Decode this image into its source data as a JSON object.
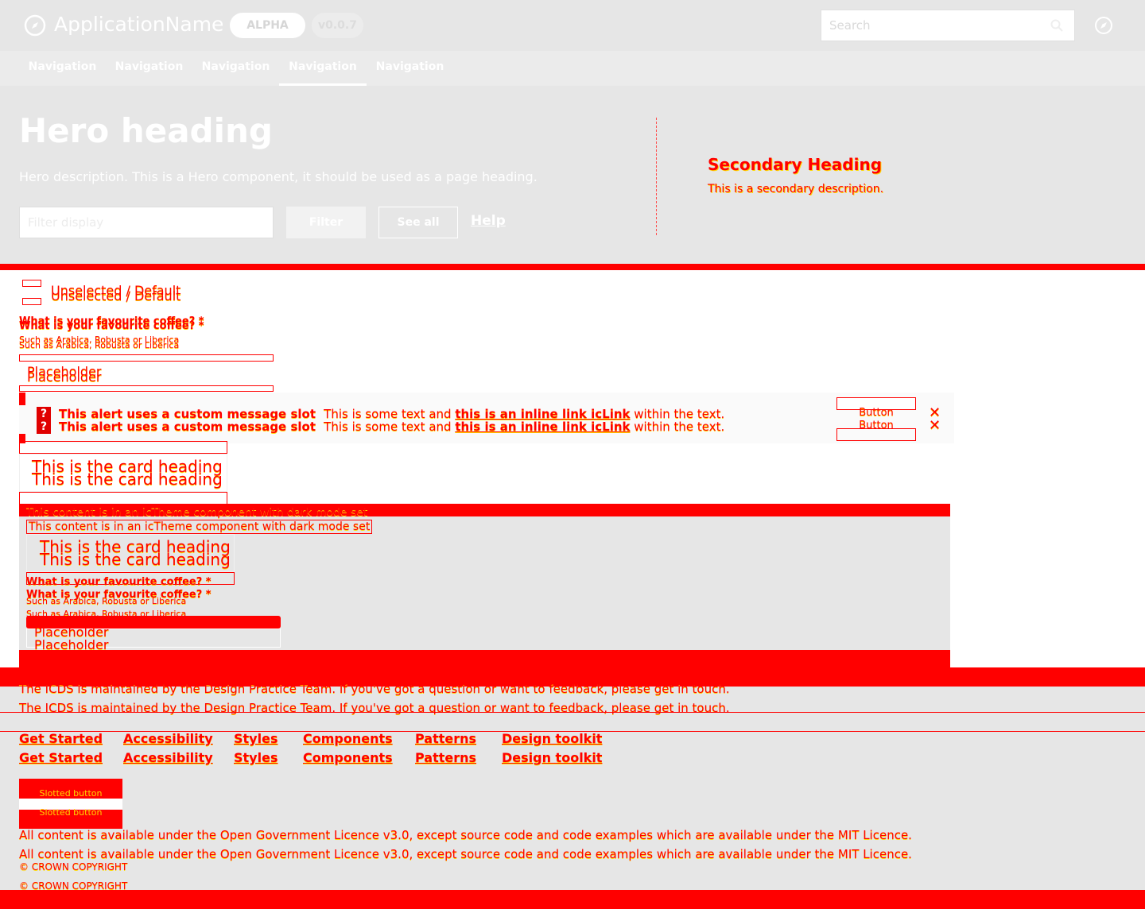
{
  "header": {
    "app_name": "ApplicationName",
    "badge_alpha": "ALPHA",
    "badge_version": "v0.0.7",
    "search_placeholder": "Search"
  },
  "nav": {
    "items": [
      "Navigation",
      "Navigation",
      "Navigation",
      "Navigation",
      "Navigation"
    ],
    "active_index": 3
  },
  "hero": {
    "heading": "Hero heading",
    "description": "Hero description. This is a Hero component, it should be used as a page heading.",
    "filter_placeholder": "Filter display",
    "filter_button": "Filter",
    "see_all_button": "See all",
    "help_link": "Help",
    "secondary_heading": "Secondary Heading",
    "secondary_description": "This is a secondary description."
  },
  "form": {
    "checkbox_label": "Unselected / Default",
    "question": "What is your favourite coffee? *",
    "helper": "Such as Arabica, Robusta or Liberica",
    "placeholder": "Placeholder"
  },
  "alert": {
    "icon": "?",
    "title": "This alert uses a custom message slot",
    "text_before": "This is some text and ",
    "link_text": "this is an inline link icLink",
    "text_after": " within the text.",
    "button": "Button",
    "close": "✕"
  },
  "card": {
    "heading": "This is the card heading"
  },
  "theme": {
    "notice": "This content is in an icTheme component with dark mode set"
  },
  "footer": {
    "maintained": "The ICDS is maintained by the Design Practice Team. If you've got a question or want to feedback, please get in touch.",
    "links": [
      "Get Started",
      "Accessibility",
      "Styles",
      "Components",
      "Patterns",
      "Design toolkit"
    ],
    "slotted_button": "Slotted button",
    "licence": "All content is available under the Open Government Licence v3.0, except source code and code examples which are available under the MIT Licence.",
    "copyright": "© CROWN COPYRIGHT"
  },
  "colors": {
    "accent": "#ff0000",
    "shadow": "#ffd700",
    "surface": "#e6e6e6"
  }
}
